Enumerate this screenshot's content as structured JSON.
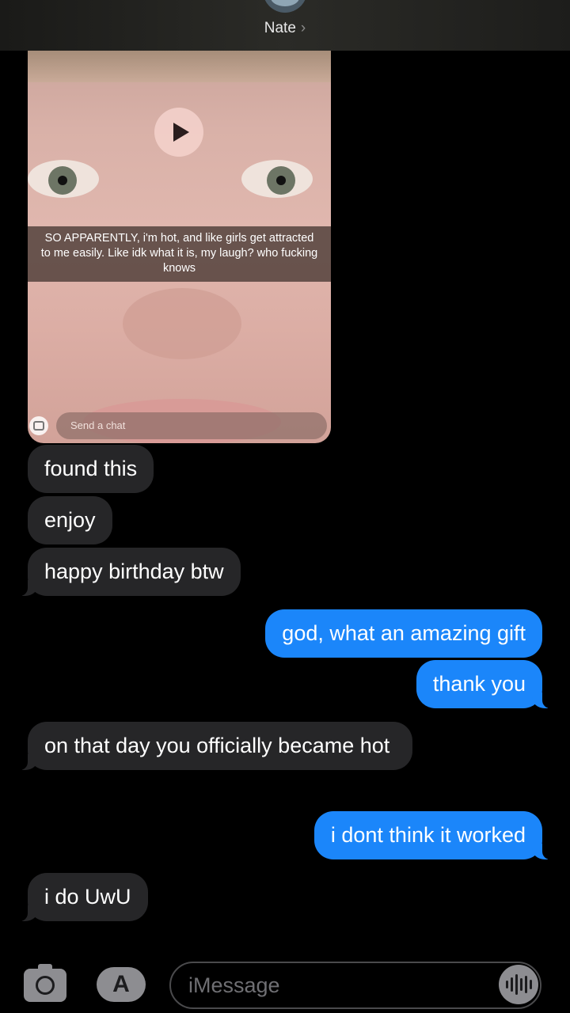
{
  "header": {
    "contact_name": "Nate",
    "chevron": "›"
  },
  "snap": {
    "caption": "SO APPARENTLY, i'm hot, and like girls get attracted to me easily. Like idk what it is, my laugh? who fucking knows",
    "send_placeholder": "Send a chat",
    "play_icon": "play-icon"
  },
  "messages": [
    {
      "side": "received",
      "text": "found this"
    },
    {
      "side": "received",
      "text": "enjoy"
    },
    {
      "side": "received",
      "text": "happy birthday btw"
    },
    {
      "side": "sent",
      "text": "god, what an amazing gift"
    },
    {
      "side": "sent",
      "text": "thank you"
    },
    {
      "side": "received",
      "text": "on that day you officially became hot"
    },
    {
      "side": "sent",
      "text": "i dont think it worked"
    },
    {
      "side": "received",
      "text": "i do UwU"
    }
  ],
  "input_bar": {
    "placeholder": "iMessage",
    "appstore_glyph": "A"
  },
  "colors": {
    "sent": "#1b86fa",
    "received": "#262628",
    "background": "#000000"
  }
}
